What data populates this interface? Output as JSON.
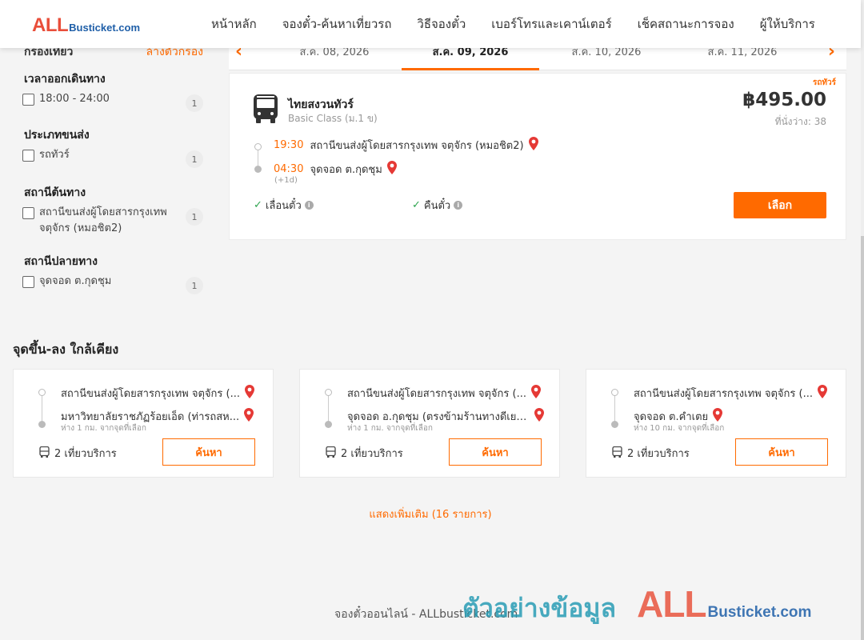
{
  "header": {
    "logo_all": "ALL",
    "logo_rest": "Busticket.com",
    "nav": [
      "หน้าหลัก",
      "จองตั๋ว-ค้นหาเที่ยวรถ",
      "วิธีจองตั๋ว",
      "เบอร์โทรและเคาน์เตอร์",
      "เช็คสถานะการจอง",
      "ผู้ให้บริการ"
    ]
  },
  "filters": {
    "title": "กรองเที่ยว",
    "clear": "ล้างตัวกรอง",
    "groups": [
      {
        "title": "เวลาออกเดินทาง",
        "option": "18:00 - 24:00",
        "count": "1"
      },
      {
        "title": "ประเภทขนส่ง",
        "option": "รถทัวร์",
        "count": "1"
      },
      {
        "title": "สถานีต้นทาง",
        "option": "สถานีขนส่งผู้โดยสารกรุงเทพ จตุจักร (หมอชิต2)",
        "count": "1"
      },
      {
        "title": "สถานีปลายทาง",
        "option": "จุดจอด ต.กุดชุม",
        "count": "1"
      }
    ]
  },
  "dates": [
    "ส.ค. 08, 2026",
    "ส.ค. 09, 2026",
    "ส.ค. 10, 2026",
    "ส.ค. 11, 2026"
  ],
  "trip": {
    "tag": "รถทัวร์",
    "operator": "ไทยสงวนทัวร์",
    "class": "Basic Class (ม.1 ข)",
    "price": "฿495.00",
    "seats": "ที่นั่งว่าง: 38",
    "dep_time": "19:30",
    "dep_station": "สถานีขนส่งผู้โดยสารกรุงเทพ จตุจักร (หมอชิต2)",
    "arr_time": "04:30",
    "arr_station": "จุดจอด ต.กุดชุม",
    "next_day": "(+1d)",
    "feature1": "เลื่อนตั๋ว",
    "feature2": "คืนตั๋ว",
    "select": "เลือก"
  },
  "nearby": {
    "title": "จุดขึ้น-ลง ใกล้เคียง",
    "cards": [
      {
        "from": "สถานีขนส่งผู้โดยสารกรุงเทพ จตุจักร (...",
        "to": "มหาวิทยาลัยราชภัฏร้อยเอ็ด (ท่ารถสห...",
        "dist": "ห่าง 1 กม. จากจุดที่เลือก",
        "trips": "2 เที่ยวบริการ",
        "search": "ค้นหา"
      },
      {
        "from": "สถานีขนส่งผู้โดยสารกรุงเทพ จตุจักร (...",
        "to": "จุดจอด อ.กุดชุม (ตรงข้ามร้านทางดีเยา...",
        "dist": "ห่าง 1 กม. จากจุดที่เลือก",
        "trips": "2 เที่ยวบริการ",
        "search": "ค้นหา"
      },
      {
        "from": "สถานีขนส่งผู้โดยสารกรุงเทพ จตุจักร (...",
        "to": "จุดจอด ต.คำเตย",
        "dist": "ห่าง 10 กม. จากจุดที่เลือก",
        "trips": "2 เที่ยวบริการ",
        "search": "ค้นหา"
      }
    ],
    "show_more": "แสดงเพิ่มเติม (16 รายการ)"
  },
  "footer": {
    "text": "จองตั๋วออนไลน์ - ALLbusticket.com",
    "watermark_th": "ตัวอย่างข้อมูล",
    "watermark_all": "ALL",
    "watermark_rest": "Busticket.com"
  },
  "colors": {
    "accent": "#ff6a00",
    "logo_red": "#e94e3a",
    "logo_blue": "#1f5fa8",
    "check": "#2ea44f",
    "pin": "#e53935"
  }
}
